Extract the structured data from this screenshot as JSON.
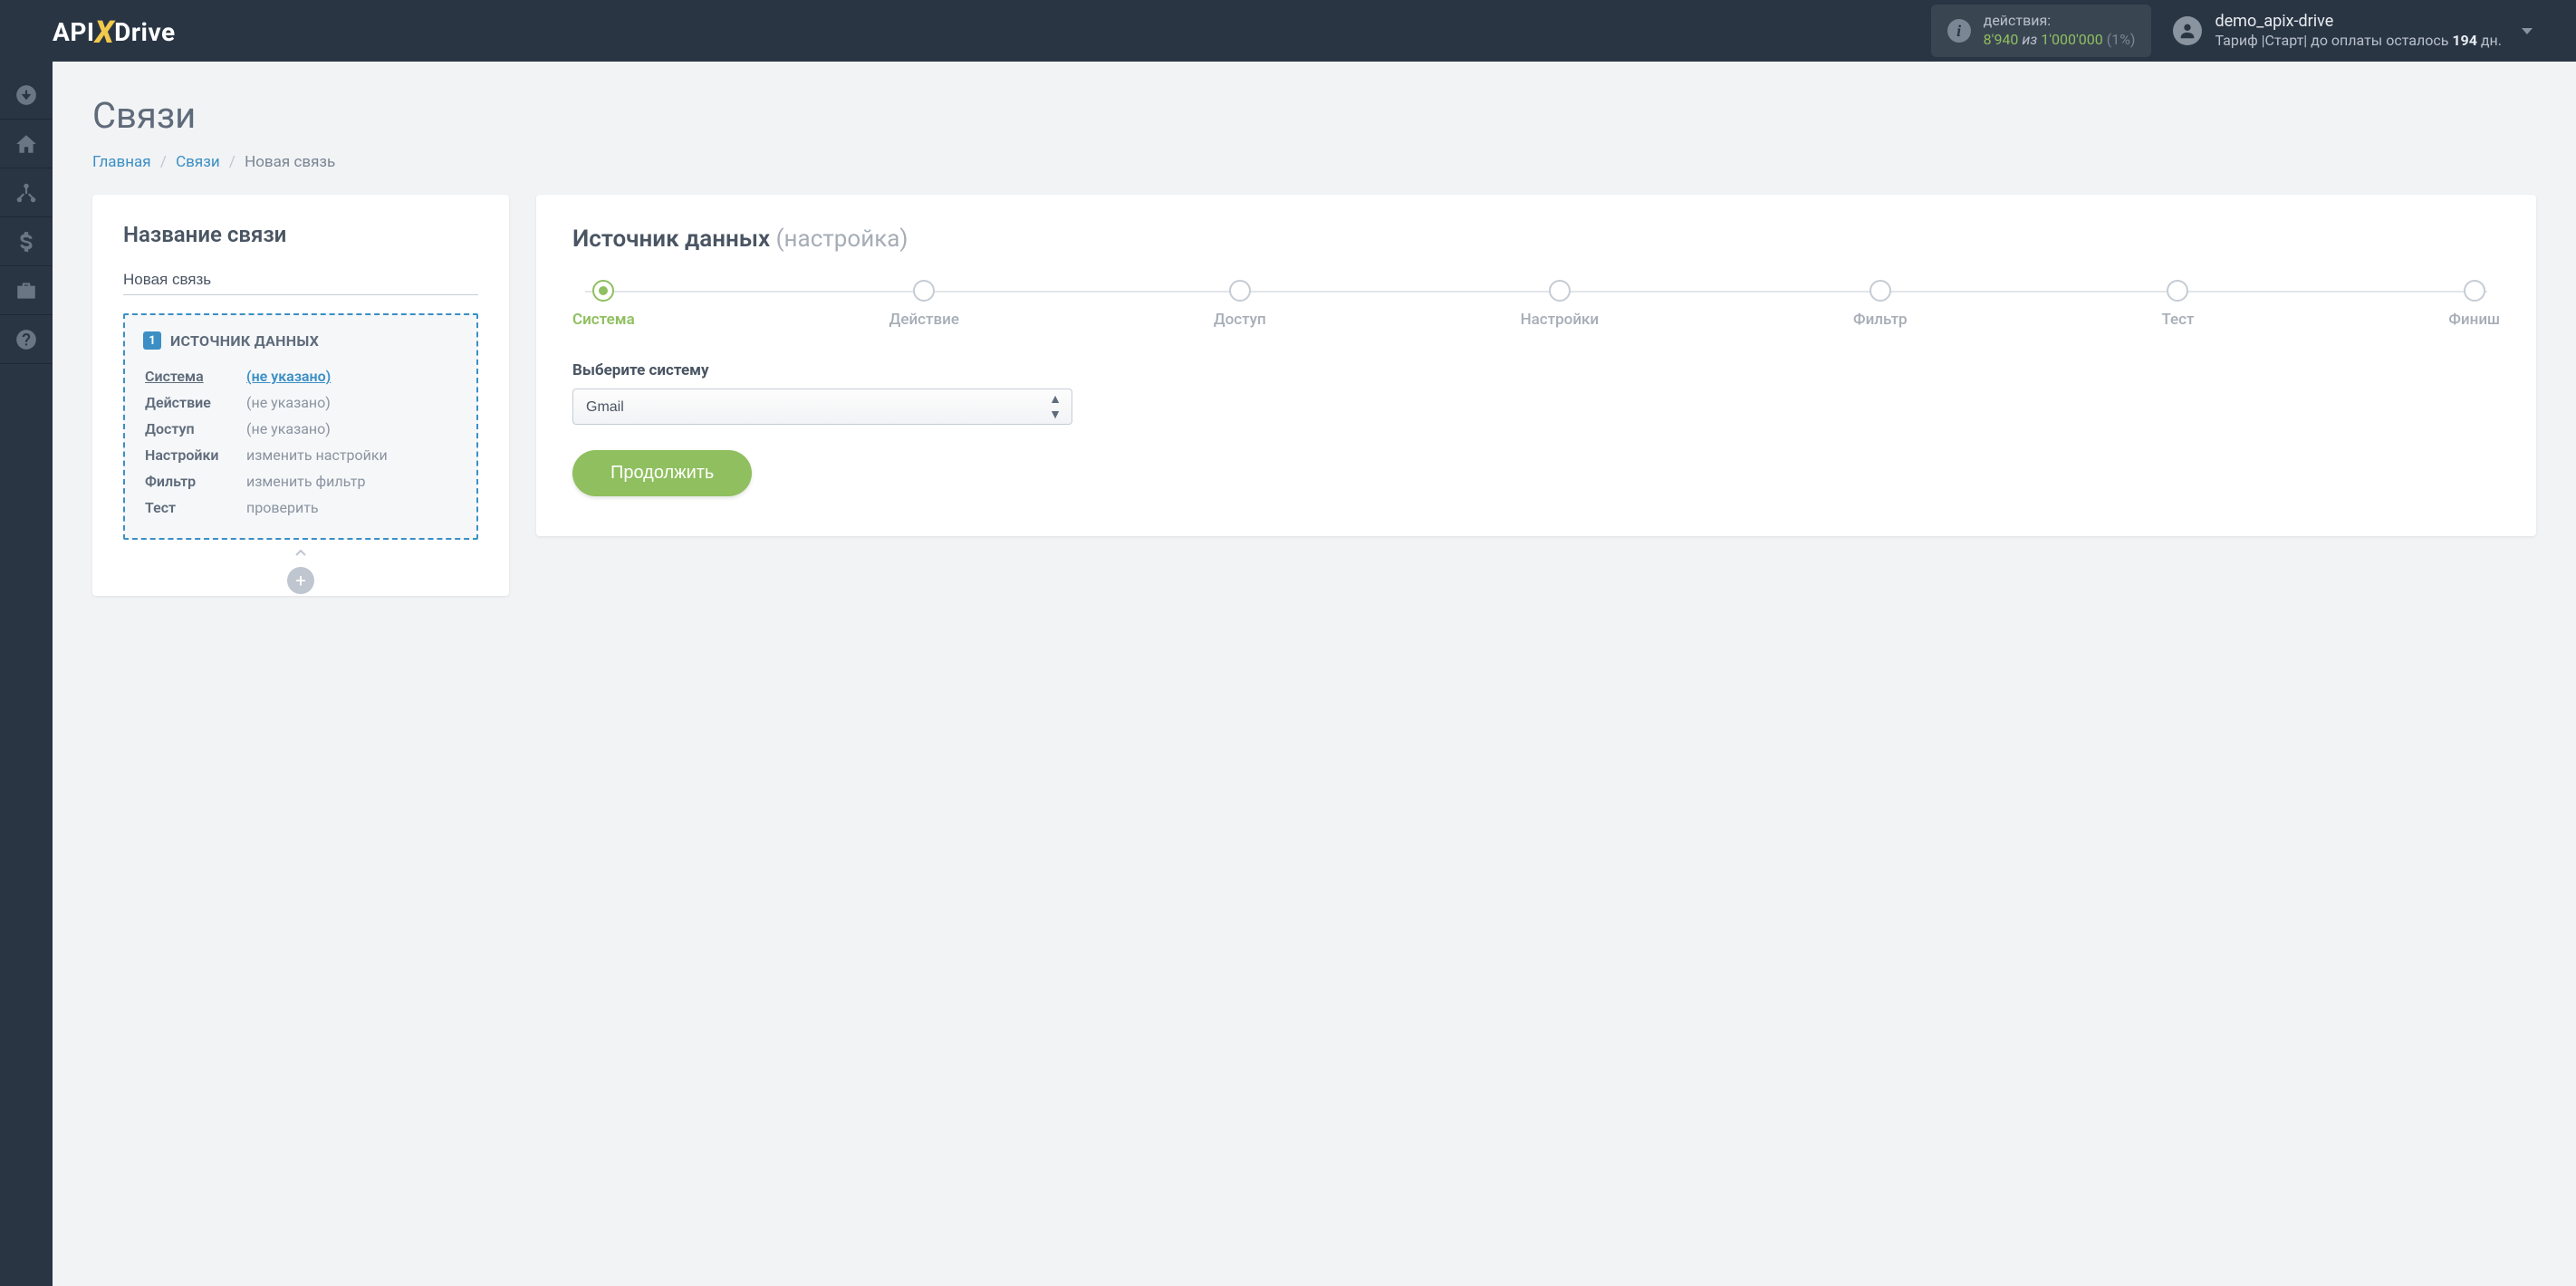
{
  "header": {
    "logo": {
      "api": "API",
      "x": "X",
      "drive": "Drive"
    },
    "actions": {
      "label": "действия:",
      "used": "8'940",
      "iz": "из",
      "limit": "1'000'000",
      "pct": "(1%)"
    },
    "user": {
      "name": "demo_apix-drive",
      "tariff_prefix": "Тариф |Старт| до оплаты осталось ",
      "days": "194",
      "days_suffix": " дн."
    }
  },
  "page": {
    "title": "Связи",
    "breadcrumb": {
      "home": "Главная",
      "links": "Связи",
      "current": "Новая связь"
    }
  },
  "left": {
    "heading": "Название связи",
    "name_value": "Новая связь",
    "source_heading": "ИСТОЧНИК ДАННЫХ",
    "badge": "1",
    "rows": [
      {
        "k": "Система",
        "v": "(не указано)",
        "active": true
      },
      {
        "k": "Действие",
        "v": "(не указано)",
        "active": false
      },
      {
        "k": "Доступ",
        "v": "(не указано)",
        "active": false
      },
      {
        "k": "Настройки",
        "v": "изменить настройки",
        "active": false
      },
      {
        "k": "Фильтр",
        "v": "изменить фильтр",
        "active": false
      },
      {
        "k": "Тест",
        "v": "проверить",
        "active": false
      }
    ]
  },
  "right": {
    "heading": "Источник данных",
    "heading_sub": "(настройка)",
    "steps": [
      {
        "label": "Система",
        "active": true
      },
      {
        "label": "Действие",
        "active": false
      },
      {
        "label": "Доступ",
        "active": false
      },
      {
        "label": "Настройки",
        "active": false
      },
      {
        "label": "Фильтр",
        "active": false
      },
      {
        "label": "Тест",
        "active": false
      },
      {
        "label": "Финиш",
        "active": false
      }
    ],
    "select_label": "Выберите систему",
    "select_value": "Gmail",
    "continue": "Продолжить"
  }
}
